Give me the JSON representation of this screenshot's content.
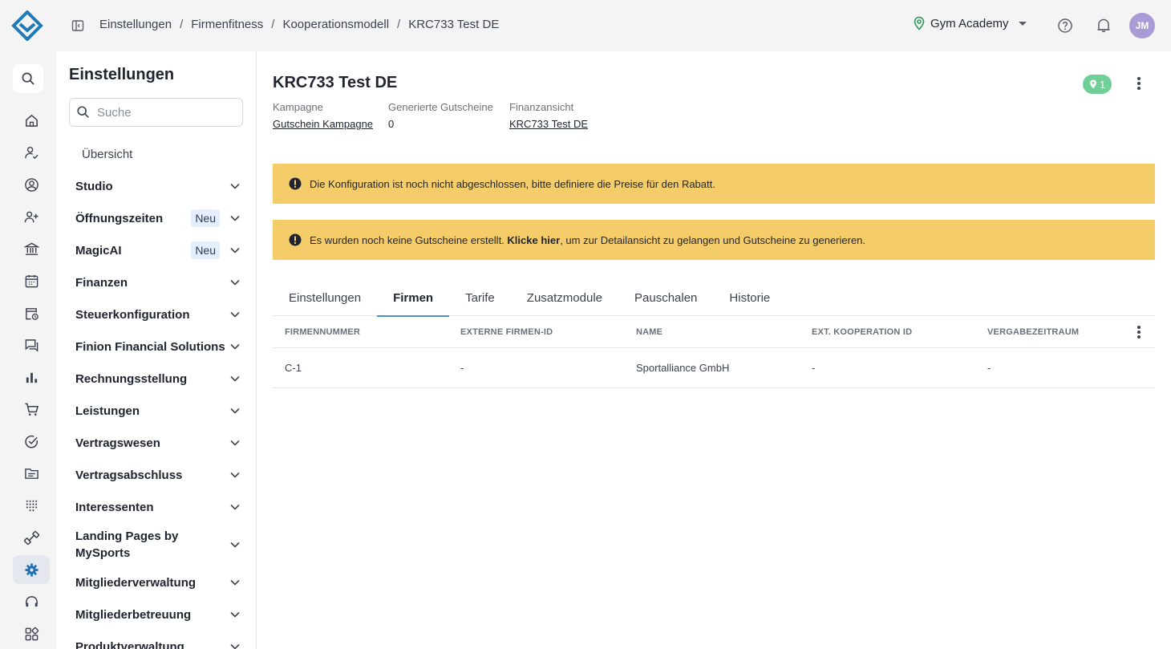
{
  "breadcrumb": [
    "Einstellungen",
    "Firmenfitness",
    "Kooperationsmodell",
    "KRC733 Test DE"
  ],
  "header": {
    "studio": "Gym Academy",
    "avatar_initials": "JM"
  },
  "settings": {
    "title": "Einstellungen",
    "search_placeholder": "Suche",
    "overview": "Übersicht",
    "items": [
      {
        "label": "Studio"
      },
      {
        "label": "Öffnungszeiten",
        "badge": "Neu"
      },
      {
        "label": "MagicAI",
        "badge": "Neu"
      },
      {
        "label": "Finanzen"
      },
      {
        "label": "Steuerkonfiguration"
      },
      {
        "label": "Finion Financial Solutions"
      },
      {
        "label": "Rechnungsstellung"
      },
      {
        "label": "Leistungen"
      },
      {
        "label": "Vertragswesen"
      },
      {
        "label": "Vertragsabschluss"
      },
      {
        "label": "Interessenten"
      },
      {
        "label": "Landing Pages by MySports"
      },
      {
        "label": "Mitgliederverwaltung"
      },
      {
        "label": "Mitgliederbetreuung"
      },
      {
        "label": "Produktverwaltung"
      }
    ]
  },
  "page": {
    "title": "KRC733 Test DE",
    "location_count": "1",
    "meta": {
      "campaign_label": "Kampagne",
      "campaign_value": "Gutschein Kampagne",
      "vouchers_label": "Generierte Gutscheine",
      "vouchers_value": "0",
      "finance_label": "Finanzansicht",
      "finance_value": "KRC733 Test DE"
    },
    "alert1": "Die Konfiguration ist noch nicht abgeschlossen, bitte definiere die Preise für den Rabatt.",
    "alert2_pre": "Es wurden noch keine Gutscheine erstellt. ",
    "alert2_link": "Klicke hier",
    "alert2_post": ", um zur Detailansicht zu gelangen und Gutscheine zu generieren.",
    "tabs": [
      "Einstellungen",
      "Firmen",
      "Tarife",
      "Zusatzmodule",
      "Pauschalen",
      "Historie"
    ],
    "active_tab": "Firmen",
    "table": {
      "columns": [
        "Firmennummer",
        "Externe Firmen-ID",
        "Name",
        "Ext. Kooperation ID",
        "Vergabezeitraum"
      ],
      "rows": [
        [
          "C-1",
          "-",
          "Sportalliance GmbH",
          "-",
          "-"
        ]
      ]
    }
  },
  "colors": {
    "accent": "#4a90c9",
    "warning": "#f4cd6a",
    "success": "#6fcf97",
    "avatar": "#a99bd6",
    "logo": "#1e7bb8"
  }
}
